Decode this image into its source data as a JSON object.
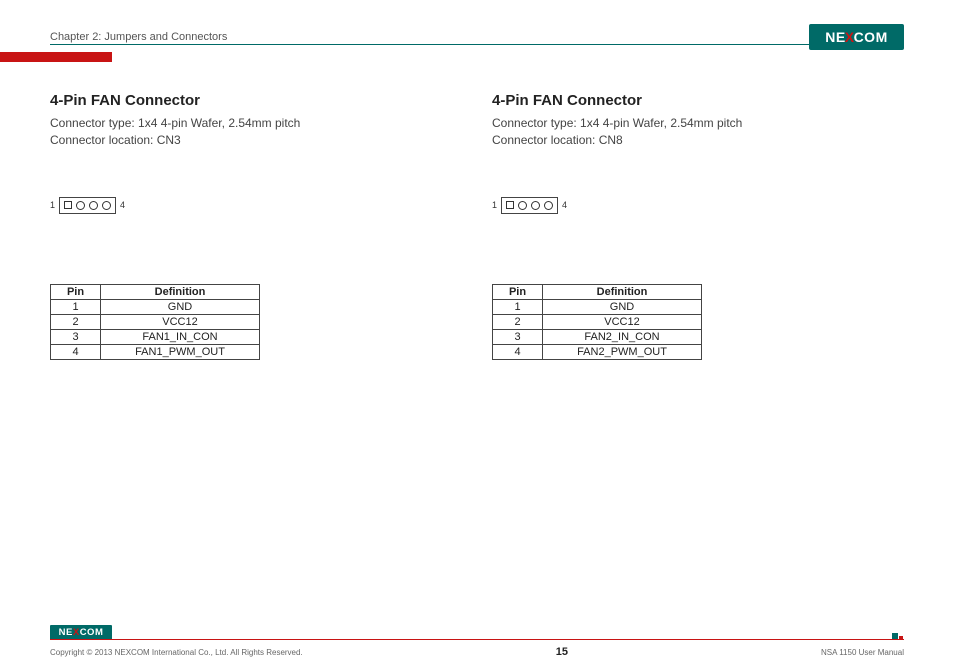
{
  "header": {
    "chapter": "Chapter 2: Jumpers and Connectors",
    "brand": "NEXCOM"
  },
  "columns": [
    {
      "title": "4-Pin FAN Connector",
      "type_line": "Connector type: 1x4 4-pin Wafer, 2.54mm pitch",
      "loc_line": "Connector location: CN3",
      "pin_start": "1",
      "pin_end": "4",
      "table_headers": {
        "pin": "Pin",
        "def": "Definition"
      },
      "rows": [
        {
          "pin": "1",
          "def": "GND"
        },
        {
          "pin": "2",
          "def": "VCC12"
        },
        {
          "pin": "3",
          "def": "FAN1_IN_CON"
        },
        {
          "pin": "4",
          "def": "FAN1_PWM_OUT"
        }
      ]
    },
    {
      "title": "4-Pin FAN Connector",
      "type_line": "Connector type: 1x4 4-pin Wafer, 2.54mm pitch",
      "loc_line": "Connector location: CN8",
      "pin_start": "1",
      "pin_end": "4",
      "table_headers": {
        "pin": "Pin",
        "def": "Definition"
      },
      "rows": [
        {
          "pin": "1",
          "def": "GND"
        },
        {
          "pin": "2",
          "def": "VCC12"
        },
        {
          "pin": "3",
          "def": "FAN2_IN_CON"
        },
        {
          "pin": "4",
          "def": "FAN2_PWM_OUT"
        }
      ]
    }
  ],
  "footer": {
    "copyright": "Copyright © 2013 NEXCOM International Co., Ltd. All Rights Reserved.",
    "page": "15",
    "doc": "NSA 1150 User Manual"
  }
}
